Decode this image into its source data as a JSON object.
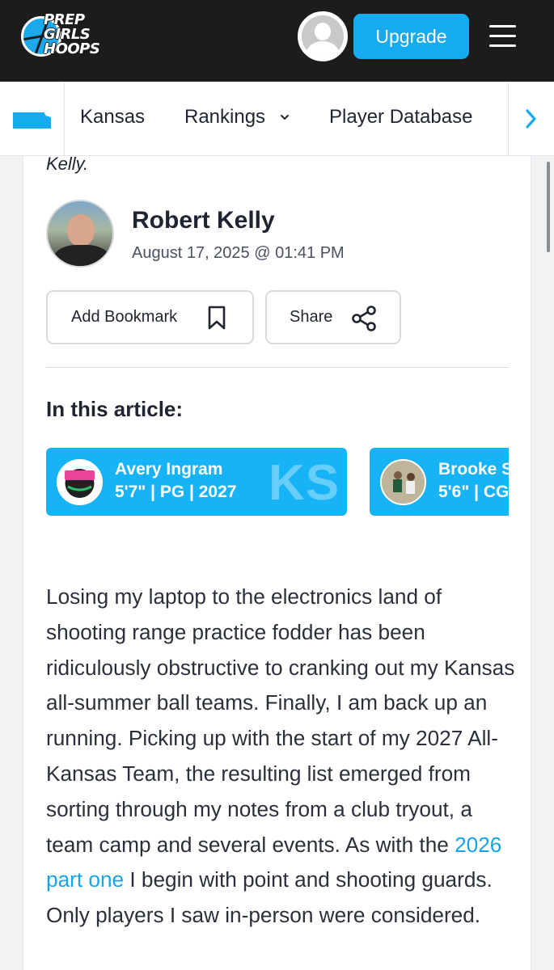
{
  "header": {
    "logo_lines": [
      "PREP",
      "GIRLS",
      "HOOPS"
    ],
    "upgrade_label": "Upgrade"
  },
  "subnav": {
    "state": "Kansas",
    "rankings": "Rankings",
    "player_database": "Player Database"
  },
  "article": {
    "lead_end": "Kelly.",
    "author": "Robert Kelly",
    "date": "August 17, 2025 @ 01:41 PM",
    "bookmark_label": "Add Bookmark",
    "share_label": "Share",
    "in_article_heading": "In this article:",
    "players": [
      {
        "name": "Avery Ingram",
        "meta": "5'7\" | PG | 2027",
        "state": "KS"
      },
      {
        "name": "Brooke S",
        "meta": "5'6\" | CG"
      }
    ],
    "body_before_link": "Losing my laptop to the electronics land of shooting range practice fodder has been ridiculously obstructive to cranking out my Kansas all-summer ball teams. Finally, I am back up an running. Picking up with the start of my 2027 All-Kansas Team, the resulting list emerged from sorting through my notes from a club tryout, a team camp and several events. As with the ",
    "body_link": "2026 part one",
    "body_after_link": " I begin with point and shooting guards. Only players I saw in-person were considered."
  },
  "colors": {
    "brand_blue": "#16aaf0",
    "header_bg": "#1c1c1c",
    "link": "#16a3e8"
  }
}
